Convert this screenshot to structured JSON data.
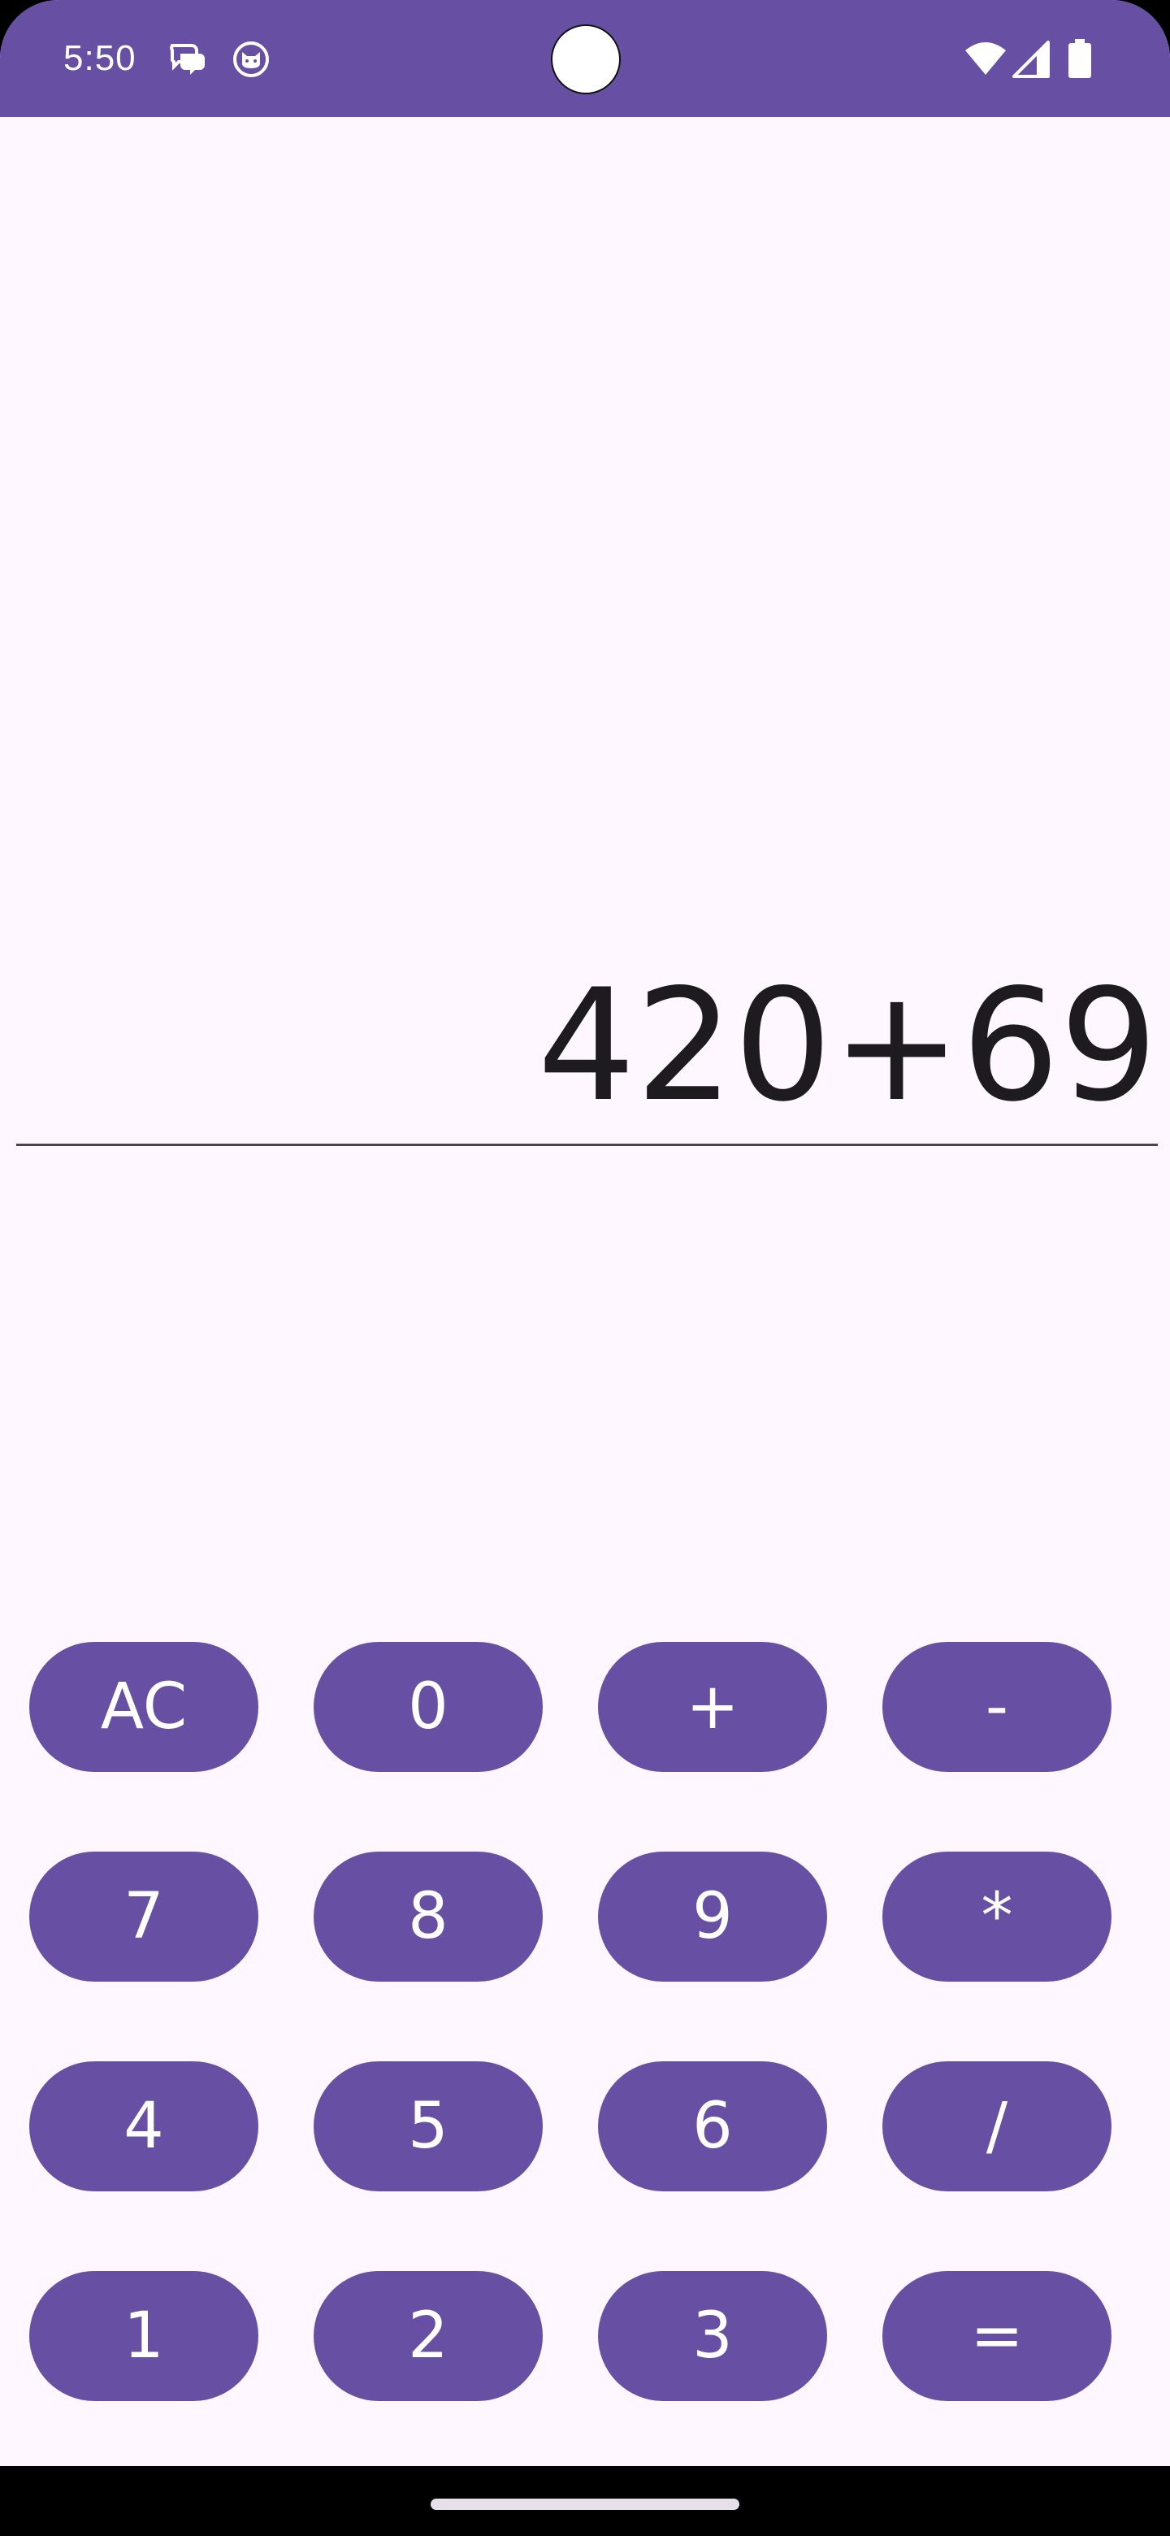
{
  "status_bar": {
    "time": "5:50",
    "left_icons": [
      "chat-bubbles-icon",
      "cat-face-icon"
    ],
    "right_icons": [
      "wifi-icon",
      "cellular-signal-icon",
      "battery-icon"
    ],
    "background_color": "#6750A4"
  },
  "display": {
    "expression": "420+69",
    "result": ""
  },
  "keypad": {
    "rows": [
      [
        {
          "id": "ac",
          "label": "AC"
        },
        {
          "id": "0",
          "label": "0"
        },
        {
          "id": "plus",
          "label": "+"
        },
        {
          "id": "minus",
          "label": "-"
        }
      ],
      [
        {
          "id": "7",
          "label": "7"
        },
        {
          "id": "8",
          "label": "8"
        },
        {
          "id": "9",
          "label": "9"
        },
        {
          "id": "multiply",
          "label": "*"
        }
      ],
      [
        {
          "id": "4",
          "label": "4"
        },
        {
          "id": "5",
          "label": "5"
        },
        {
          "id": "6",
          "label": "6"
        },
        {
          "id": "divide",
          "label": "/"
        }
      ],
      [
        {
          "id": "1",
          "label": "1"
        },
        {
          "id": "2",
          "label": "2"
        },
        {
          "id": "3",
          "label": "3"
        },
        {
          "id": "equals",
          "label": "="
        }
      ]
    ]
  },
  "colors": {
    "primary": "#6750A4",
    "background": "#FEF7FF",
    "on_primary": "#FFFFFF",
    "text": "#1D1B20"
  }
}
